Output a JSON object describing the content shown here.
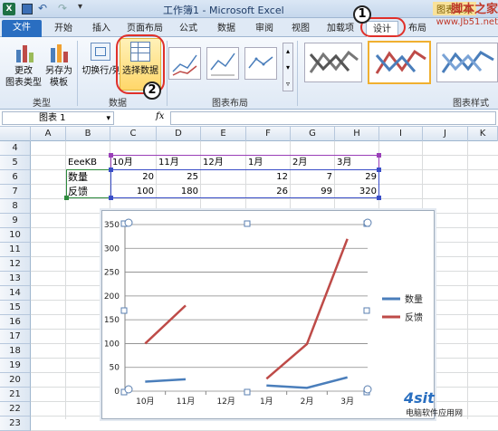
{
  "window": {
    "title": "工作簿1 - Microsoft Excel",
    "context_tools": "图表工具"
  },
  "watermark_top": {
    "text1": "脚本之家",
    "url": "www.Jb51.net"
  },
  "watermark_bottom": {
    "text1": "电脑软件应用网"
  },
  "tabs": [
    "文件",
    "开始",
    "插入",
    "页面布局",
    "公式",
    "数据",
    "审阅",
    "视图",
    "加载项",
    "设计",
    "布局"
  ],
  "ribbon": {
    "change_type": "更改\n图表类型",
    "save_template": "另存为\n模板",
    "switch_row_col": "切换行/列",
    "select_data": "选择数据",
    "group_type": "类型",
    "group_data": "数据",
    "group_layout": "图表布局",
    "group_style": "图表样式"
  },
  "callouts": {
    "one": "1",
    "two": "2"
  },
  "formula_bar": {
    "name_box": "图表 1",
    "fx": "fx",
    "value": ""
  },
  "columns": [
    "A",
    "B",
    "C",
    "D",
    "E",
    "F",
    "G",
    "H",
    "I",
    "J",
    "K"
  ],
  "rows": [
    "4",
    "5",
    "6",
    "7",
    "8",
    "9",
    "10",
    "11",
    "12",
    "13",
    "14",
    "15",
    "16",
    "17",
    "18",
    "19",
    "20",
    "21",
    "22",
    "23"
  ],
  "sheet": {
    "header_label": "EeeKB",
    "months": [
      "10月",
      "11月",
      "12月",
      "1月",
      "2月",
      "3月"
    ],
    "row1_label": "数量",
    "row1_values": [
      "20",
      "25",
      "",
      "12",
      "7",
      "29"
    ],
    "row2_label": "反馈",
    "row2_values": [
      "100",
      "180",
      "",
      "26",
      "99",
      "320"
    ]
  },
  "chart_data": {
    "type": "line",
    "categories": [
      "10月",
      "11月",
      "12月",
      "1月",
      "2月",
      "3月"
    ],
    "series": [
      {
        "name": "数量",
        "values": [
          20,
          25,
          null,
          12,
          7,
          29
        ],
        "color": "#4a7ebb"
      },
      {
        "name": "反馈",
        "values": [
          100,
          180,
          null,
          26,
          99,
          320
        ],
        "color": "#be4b48"
      }
    ],
    "ylim": [
      0,
      350
    ],
    "yticks": [
      "0",
      "50",
      "100",
      "150",
      "200",
      "250",
      "300",
      "350"
    ],
    "grid": true,
    "legend": "right"
  }
}
